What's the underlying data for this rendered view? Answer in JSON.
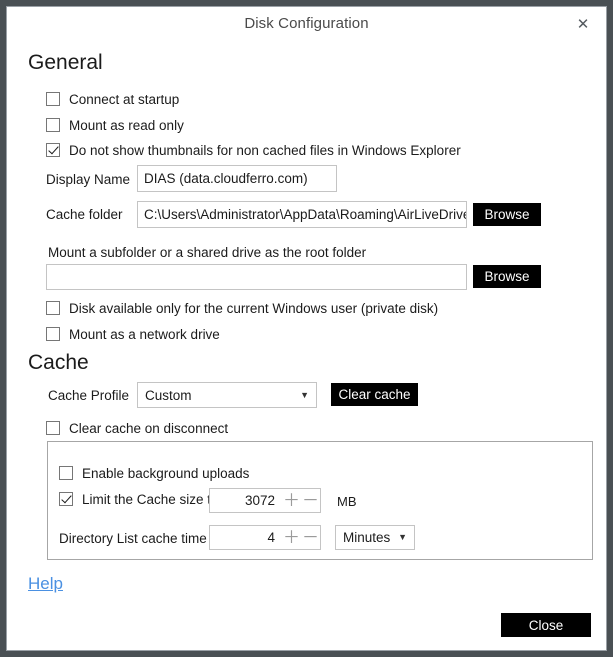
{
  "window": {
    "title": "Disk Configuration",
    "close_icon": "close-icon",
    "close_glyph": "✕"
  },
  "general": {
    "heading": "General",
    "checkboxes": [
      {
        "label": "Connect at startup",
        "checked": false
      },
      {
        "label": "Mount as read only",
        "checked": false
      },
      {
        "label": "Do not show thumbnails for non cached files in Windows Explorer",
        "checked": true
      }
    ],
    "display_name": {
      "label": "Display Name",
      "value": "DIAS (data.cloudferro.com)",
      "placeholder": ""
    },
    "cache_folder": {
      "label": "Cache folder",
      "value": "C:\\Users\\Administrator\\AppData\\Roaming\\AirLiveDrive\\Disk",
      "placeholder": "",
      "browse_label": "Browse"
    },
    "subfolder": {
      "label": "Mount a subfolder or a shared drive as the root folder",
      "value": "",
      "placeholder": "",
      "browse_label": "Browse"
    },
    "checkboxes_bottom": [
      {
        "label": "Disk available only for the current Windows user (private disk)",
        "checked": false
      },
      {
        "label": "Mount as a network drive",
        "checked": false
      }
    ]
  },
  "cache": {
    "heading": "Cache",
    "profile": {
      "label": "Cache Profile",
      "value": "Custom",
      "caret_glyph": "▼",
      "options": [
        "Custom"
      ]
    },
    "clear_cache_button": "Clear cache",
    "clear_on_disconnect": {
      "label": "Clear cache on disconnect",
      "checked": false
    },
    "group": {
      "background_uploads": {
        "label": "Enable background uploads",
        "checked": false
      },
      "limit_size": {
        "label": "Limit the Cache size to",
        "checked": true,
        "value": "3072",
        "unit": "MB",
        "plus_glyph": "＋",
        "minus_glyph": "－"
      },
      "dir_list_cache": {
        "label": "Directory List cache time",
        "value": "4",
        "unit_value": "Minutes",
        "unit_caret": "▼",
        "unit_options": [
          "Minutes"
        ],
        "plus_glyph": "＋",
        "minus_glyph": "－"
      }
    }
  },
  "footer": {
    "help_label": "Help",
    "close_label": "Close"
  },
  "colors": {
    "window_border": "#4a5054",
    "button_dark": "#000000",
    "link": "#4a90e2",
    "groupbox_border": "#a6a6a6"
  }
}
